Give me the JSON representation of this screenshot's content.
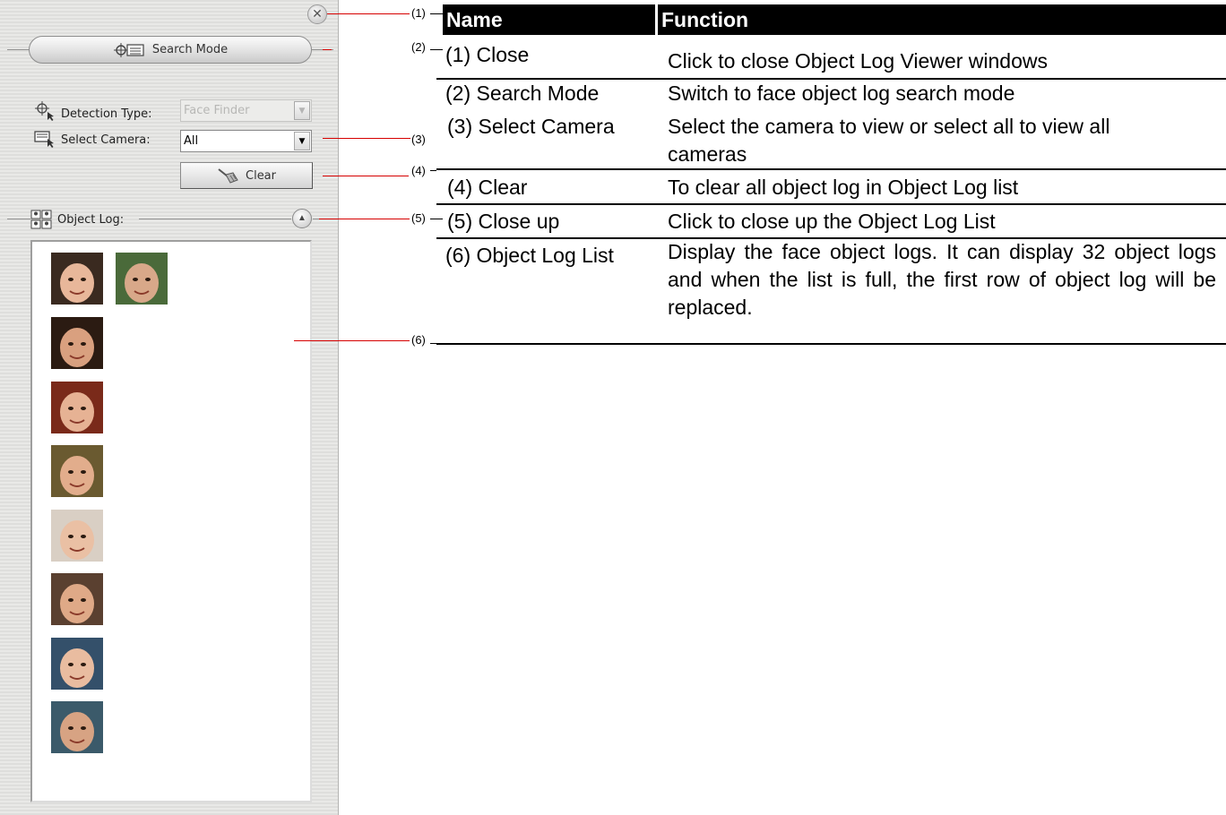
{
  "panel": {
    "search_mode_label": "Search Mode",
    "detection_type_label": "Detection Type:",
    "detection_type_value": "Face Finder",
    "select_camera_label": "Select Camera:",
    "select_camera_value": "All",
    "clear_label": "Clear",
    "object_log_label": "Object Log:",
    "close_glyph": "✕",
    "collapse_glyph": "▲",
    "dropdown_glyph": "▼"
  },
  "thumbnails": [
    {
      "name": "face-thumb-girl-smiling",
      "colors": [
        "#3a2a20",
        "#e8b79a"
      ]
    },
    {
      "name": "face-thumb-man-suit",
      "colors": [
        "#4a6a3a",
        "#d8a889"
      ]
    },
    {
      "name": "face-thumb-girl-hat",
      "colors": [
        "#2b1b12",
        "#d9a07f"
      ]
    },
    {
      "name": "face-thumb-child-costume",
      "colors": [
        "#7a2a1a",
        "#e6b294"
      ]
    },
    {
      "name": "face-thumb-boy-beanie",
      "colors": [
        "#6a5a30",
        "#e2ad8c"
      ]
    },
    {
      "name": "face-thumb-girl-glasses",
      "colors": [
        "#d9cfc4",
        "#eac0a4"
      ]
    },
    {
      "name": "face-thumb-boy-glasses",
      "colors": [
        "#5a4030",
        "#dfa987"
      ]
    },
    {
      "name": "face-thumb-girl-cap",
      "colors": [
        "#34506a",
        "#e9bca0"
      ]
    },
    {
      "name": "face-thumb-man-suit-2",
      "colors": [
        "#3b5a6a",
        "#d7a383"
      ]
    }
  ],
  "callouts": [
    "(1)",
    "(2)",
    "(3)",
    "(4)",
    "(5)",
    "(6)"
  ],
  "table": {
    "headers": [
      "Name",
      "Function"
    ],
    "rows": [
      {
        "name": "(1) Close",
        "function": "Click to close Object Log Viewer windows"
      },
      {
        "name": "(2) Search Mode",
        "function": "Switch to face object log search mode"
      },
      {
        "name": "(3) Select Camera",
        "function": "Select the camera to view or select all to view all cameras"
      },
      {
        "name": "(4) Clear",
        "function": "To clear all object log in Object Log list"
      },
      {
        "name": "(5) Close up",
        "function": "Click to close up the Object Log List"
      },
      {
        "name": "(6) Object Log List",
        "function": "Display the face object logs. It can display 32 object logs and when the list is full, the first row of object log will be replaced."
      }
    ]
  }
}
